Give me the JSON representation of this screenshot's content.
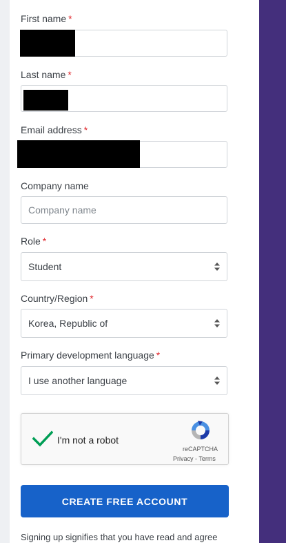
{
  "form": {
    "required_mark": "*",
    "first_name": {
      "label": "First name"
    },
    "last_name": {
      "label": "Last name"
    },
    "email": {
      "label": "Email address"
    },
    "company": {
      "label": "Company name",
      "placeholder": "Company name"
    },
    "role": {
      "label": "Role",
      "value": "Student"
    },
    "country": {
      "label": "Country/Region",
      "value": "Korea, Republic of"
    },
    "language": {
      "label": "Primary development language",
      "value": "I use another language"
    }
  },
  "captcha": {
    "label": "I'm not a robot",
    "brand": "reCAPTCHA",
    "privacy": "Privacy",
    "separator": "-",
    "terms": "Terms",
    "checked": true,
    "check_color": "#009e55"
  },
  "submit": {
    "label": "CREATE FREE ACCOUNT",
    "color": "#1762c9"
  },
  "footer": {
    "text": "Signing up signifies that you have read and agree"
  },
  "colors": {
    "accent_purple": "#442f7c",
    "required": "#e0262b"
  }
}
